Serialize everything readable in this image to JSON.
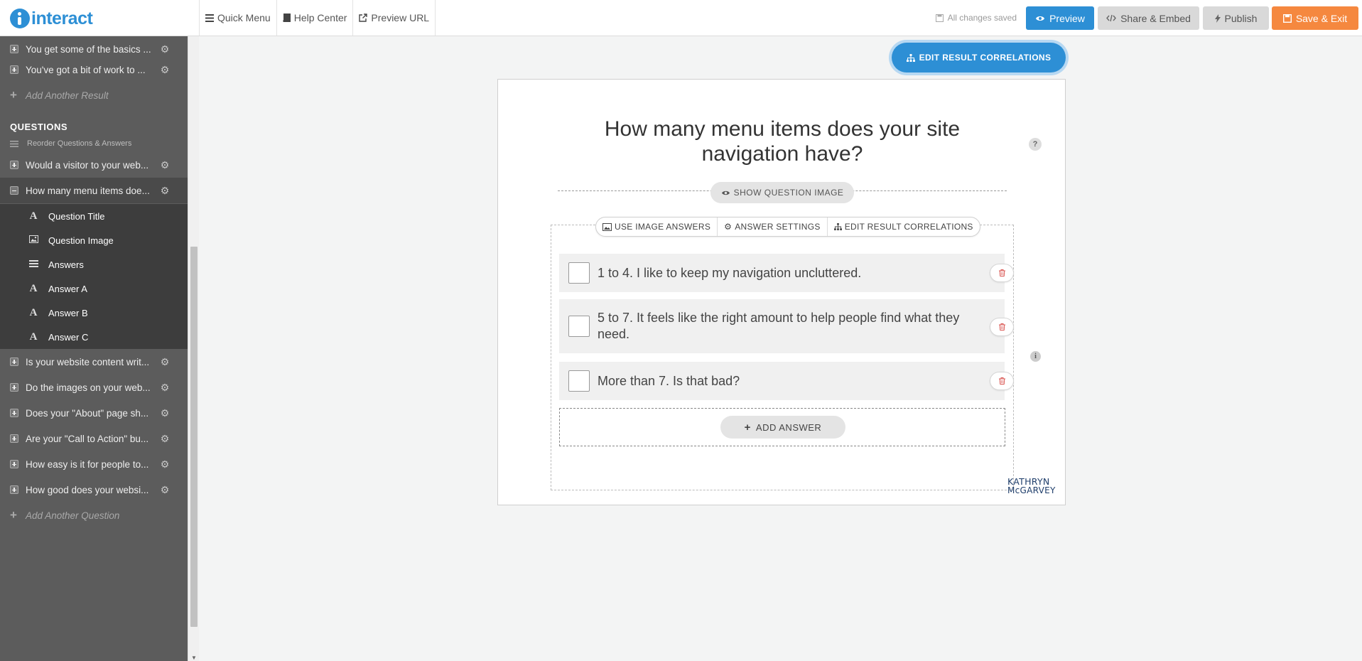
{
  "app": {
    "logo_text": "interact",
    "nav": [
      "Quick Menu",
      "Help Center",
      "Preview URL"
    ],
    "status": "All changes saved",
    "buttons": {
      "preview": "Preview",
      "share": "Share & Embed",
      "publish": "Publish",
      "save": "Save & Exit"
    },
    "colors": {
      "accent": "#2d8fd5",
      "save": "#f5883f",
      "sidebar": "#5c5c5c"
    }
  },
  "sidebar": {
    "results": [
      "You get some of the basics ...",
      "You've got a bit of work to ..."
    ],
    "add_result": "Add Another Result",
    "questions_heading": "QUESTIONS",
    "reorder": "Reorder Questions & Answers",
    "questions_before": [
      "Would a visitor to your web..."
    ],
    "active_question": "How many menu items doe...",
    "sub_items": [
      "Question Title",
      "Question Image",
      "Answers",
      "Answer A",
      "Answer B",
      "Answer C"
    ],
    "questions_after": [
      "Is your website content writ...",
      "Do the images on your web...",
      "Does your \"About\" page sh...",
      "Are your \"Call to Action\" bu...",
      "How easy is it for people to...",
      "How good does your websi..."
    ],
    "add_question": "Add Another Question"
  },
  "main": {
    "edit_correlations_top": "EDIT RESULT CORRELATIONS",
    "question_title": "How many menu items does your site navigation have?",
    "help": "?",
    "show_image": "SHOW QUESTION IMAGE",
    "answer_tools": [
      "USE IMAGE ANSWERS",
      "ANSWER SETTINGS",
      "EDIT RESULT CORRELATIONS"
    ],
    "answers": [
      "1 to 4. I like to keep my navigation uncluttered.",
      "5 to 7. It feels like the right amount to help people find what they need.",
      "More than 7. Is that bad?"
    ],
    "info": "i",
    "add_answer": "ADD ANSWER",
    "brand": [
      "KATHRYN",
      "McGARVEY"
    ]
  }
}
